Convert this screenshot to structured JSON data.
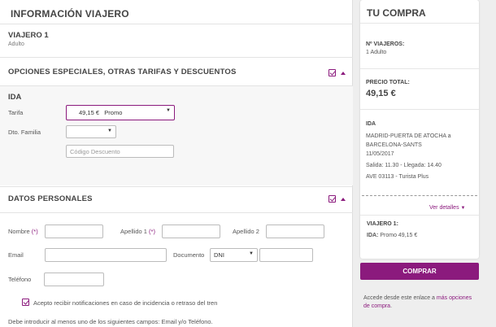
{
  "traveler_info": {
    "title": "INFORMACIÓN VIAJERO",
    "traveler_heading": "VIAJERO 1",
    "traveler_type": "Adulto"
  },
  "special_options": {
    "title": "OPCIONES ESPECIALES, OTRAS TARIFAS Y DESCUENTOS",
    "ida_label": "IDA",
    "tarifa_label": "Tarifa",
    "tarifa_price": "49,15 €",
    "tarifa_name": "Promo",
    "dto_familia_label": "Dto. Familia",
    "dto_familia_value": "",
    "codigo_placeholder": "Código Descuento"
  },
  "personal_data": {
    "title": "DATOS PERSONALES",
    "nombre_label": "Nombre",
    "apellido1_label": "Apellido 1",
    "apellido2_label": "Apellido 2",
    "required_mark": "(*)",
    "email_label": "Email",
    "documento_label": "Documento",
    "documento_value": "DNI",
    "telefono_label": "Teléfono",
    "notify_checkbox_label": "Acepto recibir notificaciones en caso de incidencia o retraso del tren",
    "footer_note": "Debe introducir al menos uno de los siguientes campos: Email y/o Teléfono."
  },
  "purchase": {
    "title": "TU COMPRA",
    "num_travelers_label": "Nº VIAJEROS:",
    "num_travelers_value": "1 Adulto",
    "total_label": "PRECIO TOTAL:",
    "total_value": "49,15 €",
    "ida_label": "IDA",
    "route": "MADRID-PUERTA DE ATOCHA a BARCELONA-SANTS",
    "date": "11/05/2017",
    "times": "Salida: 11.30 - Llegada: 14.40",
    "train": "AVE 03113 - Turista Plus",
    "details_link": "Ver detalles",
    "traveler_summary_label": "VIAJERO 1:",
    "traveler_summary_ida": "IDA:",
    "traveler_summary_value": "Promo 49,15 €",
    "buy_button": "COMPRAR",
    "more_options_prefix": "Accede desde este enlace a ",
    "more_options_link": "más opciones de compra",
    "more_options_suffix": "."
  },
  "colors": {
    "accent": "#8b1a7d",
    "panel_bg": "#eeeeee"
  }
}
